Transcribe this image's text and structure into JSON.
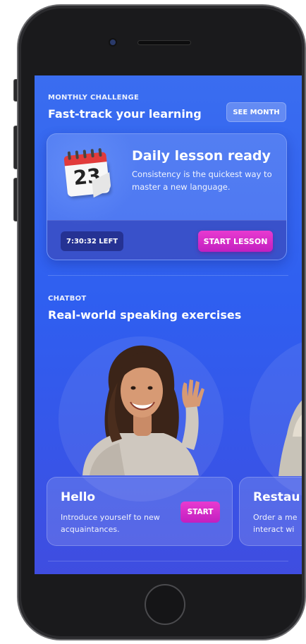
{
  "challenge": {
    "eyebrow": "MONTHLY CHALLENGE",
    "title": "Fast-track your learning",
    "see_month_label": "SEE MONTH"
  },
  "lesson": {
    "calendar_day": "23",
    "title": "Daily lesson ready",
    "description": "Consistency is the quickest way to master a new language.",
    "time_left": "7:30:32 LEFT",
    "start_label": "START LESSON"
  },
  "chatbot": {
    "eyebrow": "CHATBOT",
    "title": "Real-world speaking exercises",
    "cards": [
      {
        "title": "Hello",
        "description": "Introduce yourself to new\nacquaintances.",
        "start_label": "START"
      },
      {
        "title": "Restau",
        "description": "Order a me\ninteract wi"
      }
    ]
  },
  "colors": {
    "screen_bg": "#3461f0",
    "accent_magenta": "#d92bc8"
  },
  "icons": [
    "calendar-icon"
  ]
}
